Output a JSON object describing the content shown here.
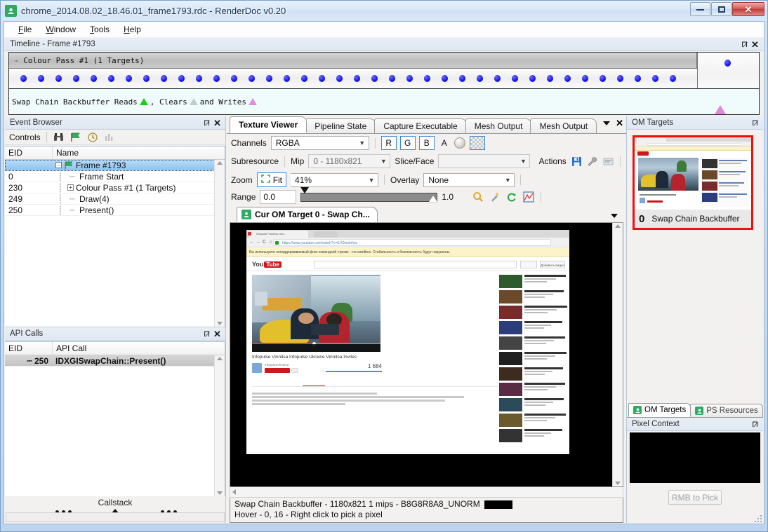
{
  "window": {
    "title": "chrome_2014.08.02_18.46.01_frame1793.rdc - RenderDoc v0.20",
    "app_icon": "renderdoc-icon",
    "minimize_label": "Minimize",
    "maximize_label": "Maximize",
    "close_label": "Close"
  },
  "menu": {
    "items": [
      {
        "label": "File",
        "mnemonic": "F"
      },
      {
        "label": "Window",
        "mnemonic": "W"
      },
      {
        "label": "Tools",
        "mnemonic": "T"
      },
      {
        "label": "Help",
        "mnemonic": "H"
      }
    ]
  },
  "timeline": {
    "title": "Timeline - Frame #1793",
    "pass_label": "- Colour Pass #1 (1 Targets)",
    "dot_count": 38,
    "legend": {
      "prefix": "Swap Chain Backbuffer Reads",
      "mid": ", Clears",
      "suffix": "and Writes",
      "read_color": "#0ed40e",
      "clear_color": "#c9c9c9",
      "write_color": "#e18ce1"
    }
  },
  "event_browser": {
    "title": "Event Browser",
    "controls_label": "Controls",
    "toolbar_icons": [
      "binoculars-icon",
      "flag-icon",
      "timer-icon",
      "bars-icon"
    ],
    "columns": [
      "EID",
      "Name"
    ],
    "rows": [
      {
        "eid": "",
        "name": "Frame #1793",
        "depth": 0,
        "expander": "-",
        "icon": "flag-icon",
        "selected": true
      },
      {
        "eid": "0",
        "name": "Frame Start",
        "depth": 1,
        "expander": "",
        "icon": "",
        "selected": false
      },
      {
        "eid": "230",
        "name": "Colour Pass #1 (1 Targets)",
        "depth": 1,
        "expander": "+",
        "icon": "",
        "selected": false
      },
      {
        "eid": "249",
        "name": "Draw(4)",
        "depth": 1,
        "expander": "",
        "icon": "",
        "selected": false
      },
      {
        "eid": "250",
        "name": "Present()",
        "depth": 1,
        "expander": "",
        "icon": "",
        "selected": false
      }
    ]
  },
  "api_calls": {
    "title": "API Calls",
    "columns": [
      "EID",
      "API Call"
    ],
    "rows": [
      {
        "eid": "250",
        "call": "IDXGISwapChain::Present()",
        "selected": true
      }
    ]
  },
  "callstack": {
    "label": "Callstack"
  },
  "main_tabs": [
    {
      "label": "Texture Viewer",
      "active": true
    },
    {
      "label": "Pipeline State",
      "active": false
    },
    {
      "label": "Capture Executable",
      "active": false
    },
    {
      "label": "Mesh Output",
      "active": false
    },
    {
      "label": "Mesh Output",
      "active": false
    }
  ],
  "texture_viewer": {
    "channels_label": "Channels",
    "channels_value": "RGBA",
    "channel_buttons": [
      "R",
      "G",
      "B"
    ],
    "alpha_label": "A",
    "subresource_label": "Subresource",
    "mip_label": "Mip",
    "mip_value": "0 - 1180x821",
    "slice_label": "Slice/Face",
    "slice_value": "",
    "actions_label": "Actions",
    "action_icons": [
      "save-icon",
      "wrench-icon",
      "open-icon"
    ],
    "zoom_label": "Zoom",
    "fit_label": "Fit",
    "zoom_value": "41%",
    "overlay_label": "Overlay",
    "overlay_value": "None",
    "range_label": "Range",
    "range_min": "0.0",
    "range_max": "1.0",
    "range_icons": [
      "magnifier-icon",
      "wand-icon",
      "reset-icon",
      "histogram-icon"
    ],
    "inner_tab": "Cur OM Target 0 - Swap Ch...",
    "status_line1": "Swap Chain Backbuffer - 1180x821 1 mips - B8G8R8A8_UNORM",
    "status_line2": "Hover - 0, 16 - Right click to pick a pixel",
    "status_swatch_color": "#000000"
  },
  "om_targets": {
    "title": "OM Targets",
    "thumb_index": "0",
    "thumb_label": "Swap Chain Backbuffer",
    "highlight_color": "#f40d0d",
    "tabs": [
      {
        "label": "OM Targets",
        "active": true
      },
      {
        "label": "PS Resources",
        "active": false
      }
    ]
  },
  "pixel_context": {
    "title": "Pixel Context",
    "button_label": "RMB to Pick"
  },
  "captured_page": {
    "browser_tab_title": "Infopulse Vinnitsa Info...",
    "url": "https://www.youtube.com/watch?v=tLX0rwvhhuc",
    "infobar": "Вы используете неподдерживаемый флаг командной строки: --no-sandbox. Стабильность и безопасность будут нарушены.",
    "yt_brand_you": "You",
    "yt_brand_tube": "Tube",
    "upload_label": "Добавить видео",
    "video_title": "Infopulse Vinnitsa Infopulse Ukraine Vinnitsa Invites",
    "channel_name": "InfopulseVinnitsa",
    "subscribe_label": "Подписаться",
    "view_count": "1 684",
    "tabs": [
      "О видео",
      "Поделиться",
      "Добавить в"
    ],
    "published": "Опубликовано: 29 мая 2013 г.",
    "description": "Would you like to work in friendly environment on interesting projects with new technologies? Test yourself to join Vinnitsa team of Infopulse Ukraine!"
  }
}
